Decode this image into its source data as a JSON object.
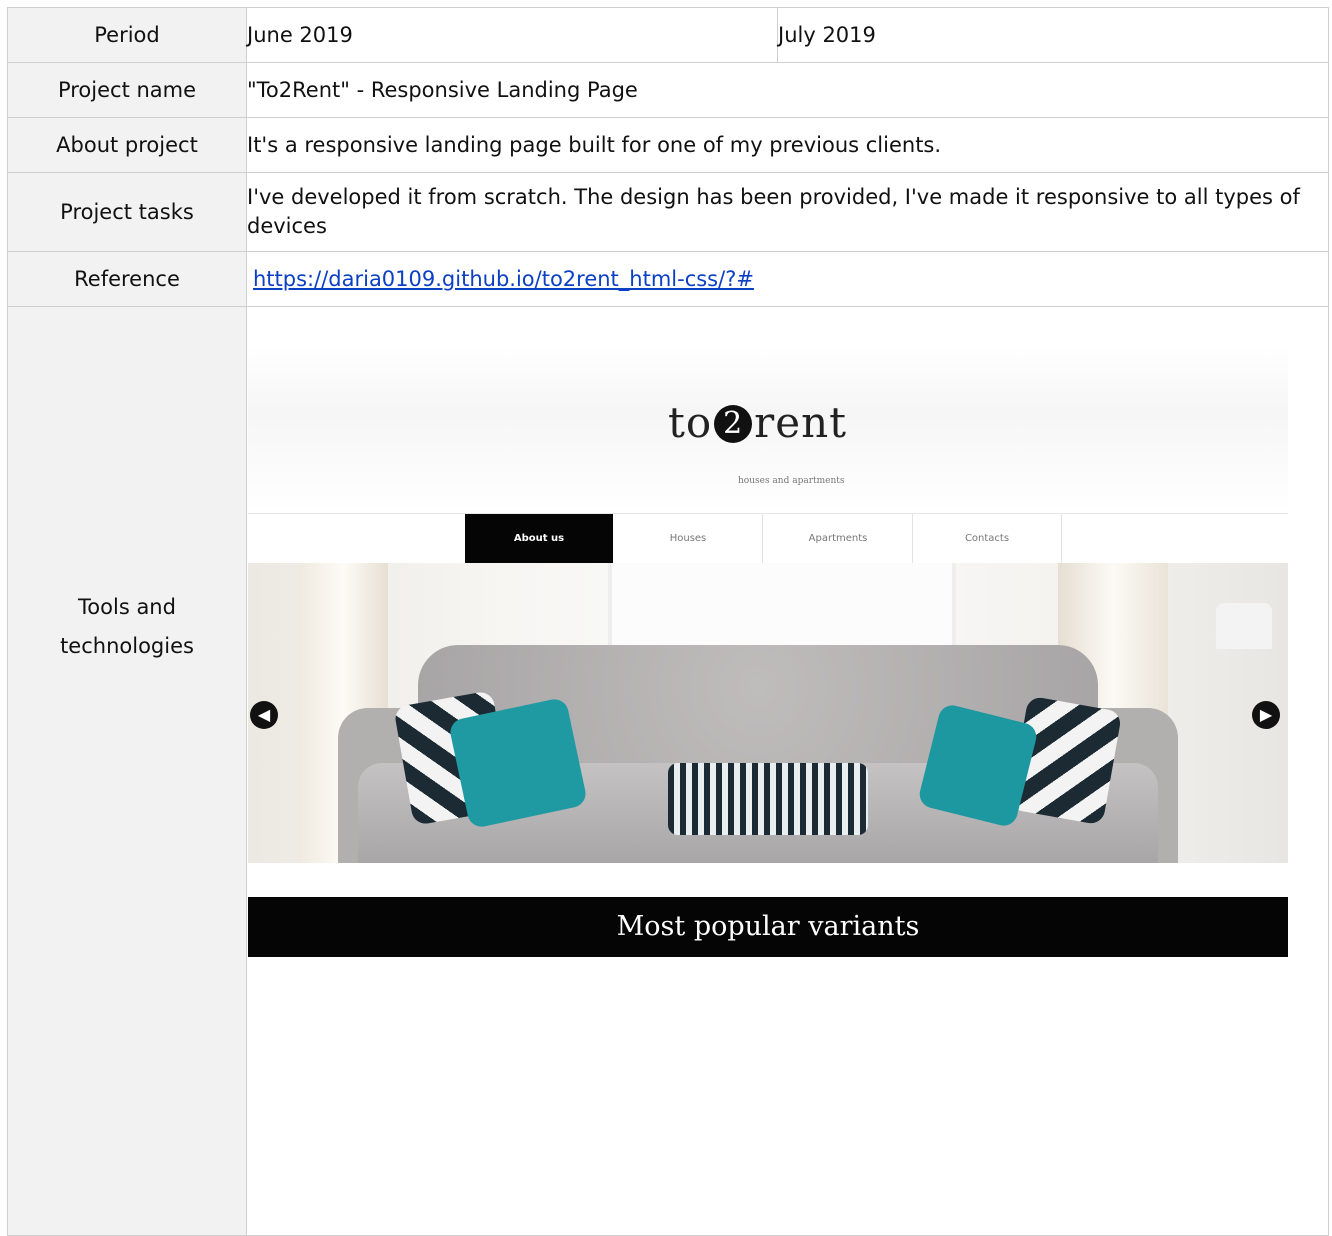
{
  "rows": {
    "period": {
      "label": "Period",
      "start": "June 2019",
      "end": "July 2019"
    },
    "project_name": {
      "label": "Project name",
      "value": "\"To2Rent\" - Responsive Landing Page"
    },
    "about": {
      "label": "About project",
      "value": "It's a responsive landing page built for one of my previous clients."
    },
    "tasks": {
      "label": "Project tasks",
      "value": "I've developed it from scratch. The design has been provided, I've made it responsive to all types of devices"
    },
    "reference": {
      "label": "Reference",
      "link": "https://daria0109.github.io/to2rent_html-css/?#"
    },
    "tools": {
      "label_line1": "Tools and",
      "label_line2": "technologies"
    }
  },
  "screenshot": {
    "logo_left": "to",
    "logo_circle": "2",
    "logo_right": "rent",
    "tagline": "houses and apartments",
    "nav": [
      "About us",
      "Houses",
      "Apartments",
      "Contacts"
    ],
    "arrow_left": "◀",
    "arrow_right": "▶",
    "band_title": "Most popular variants"
  }
}
